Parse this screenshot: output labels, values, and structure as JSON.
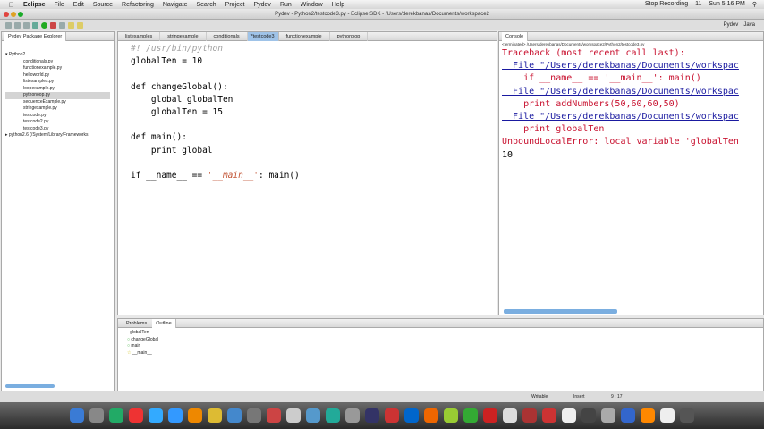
{
  "menubar": {
    "app": "Eclipse",
    "items": [
      "File",
      "Edit",
      "Source",
      "Refactoring",
      "Navigate",
      "Search",
      "Project",
      "Pydev",
      "Run",
      "Window",
      "Help"
    ],
    "status": [
      "Stop Recording",
      "11",
      "Sun 5:16 PM"
    ]
  },
  "window": {
    "title": "Pydev - Python2/testcode3.py - Eclipse SDK - /Users/derekbanas/Documents/workspace2"
  },
  "perspectives": [
    "Pydev",
    "Java"
  ],
  "explorer": {
    "title": "Pydev Package Explorer",
    "project": "Python2",
    "files": [
      "conditionals.py",
      "functionexample.py",
      "helloworld.py",
      "listexamples.py",
      "loopexample.py",
      "pythonoop.py",
      "sequenceExample.py",
      "stringexample.py",
      "testcode.py",
      "testcode2.py",
      "testcode3.py"
    ],
    "selected": 5,
    "library": "python2.6  (/System/Library/Frameworks"
  },
  "editor": {
    "tabs": [
      "listexamples",
      "stringexample",
      "conditionals",
      "*testcode3",
      "functionexample",
      "pythonoop"
    ],
    "active": 3,
    "lines": {
      "l1": "#! /usr/bin/python",
      "l2": "globalTen = 10",
      "l4": "def changeGlobal():",
      "l5": "    global globalTen",
      "l6": "    globalTen = 15",
      "l8": "def main():",
      "l9": "    print global",
      "l11a": "if __name__ == ",
      "l11b": "'__main__'",
      "l11c": ": main()"
    }
  },
  "console": {
    "title": "Console",
    "terminated": "<terminated> /Users/derekbanas/Documents/workspace2/Python2/testcode3.py",
    "lines": {
      "tb": "Traceback (most recent call last):",
      "f1": "  File \"/Users/derekbanas/Documents/workspac",
      "c1": "    if __name__ == '__main__': main()",
      "f2": "  File \"/Users/derekbanas/Documents/workspac",
      "c2": "    print addNumbers(50,60,60,50)",
      "f3": "  File \"/Users/derekbanas/Documents/workspac",
      "c3": "    print globalTen",
      "err": "UnboundLocalError: local variable 'globalTen",
      "out": "10"
    }
  },
  "outline": {
    "tabs": [
      "Problems",
      "Outline"
    ],
    "items": [
      "globalTen",
      "changeGlobal",
      "main",
      "__main__"
    ]
  },
  "statusbar": {
    "mode": "Writable",
    "insert": "Insert",
    "pos": "9 : 17"
  }
}
